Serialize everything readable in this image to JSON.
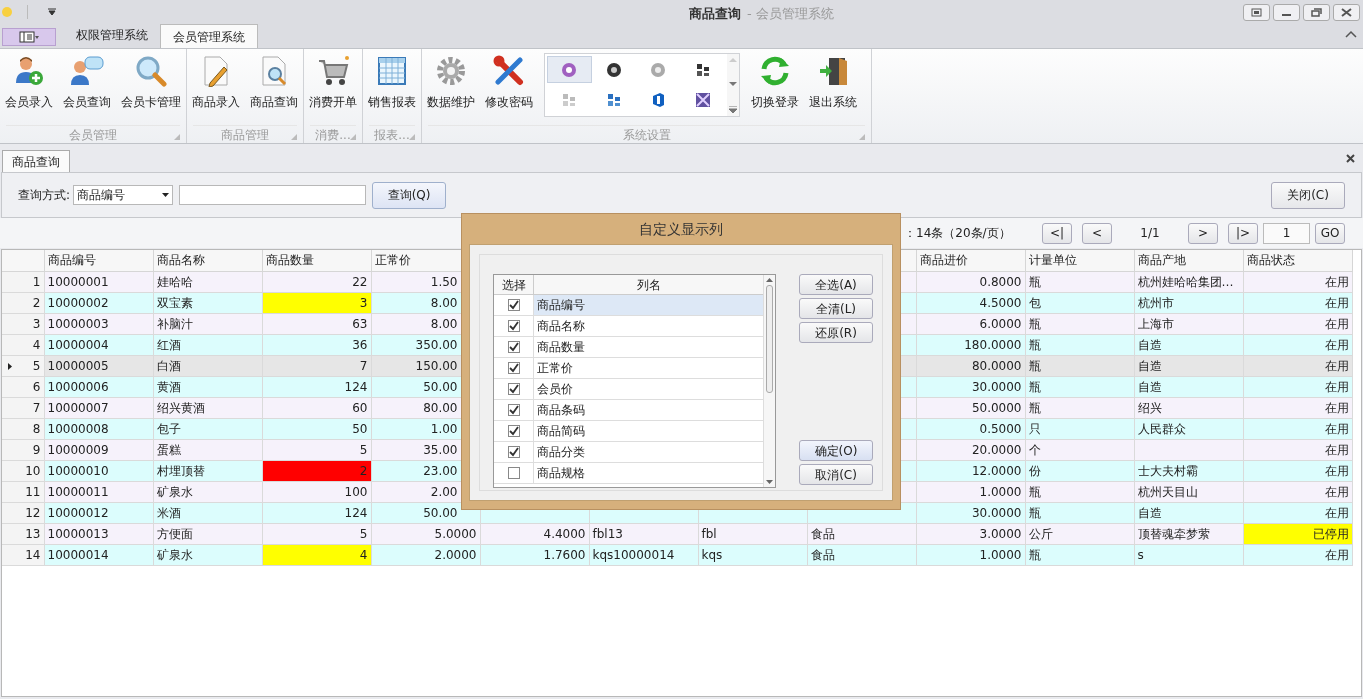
{
  "window": {
    "title": "商品查询",
    "app_name": "- 会员管理系统"
  },
  "ribbon": {
    "tabs": [
      {
        "label": "权限管理系统",
        "selected": false
      },
      {
        "label": "会员管理系统",
        "selected": true
      }
    ],
    "groups": [
      {
        "label": "会员管理",
        "items": [
          {
            "kind": "button",
            "label": "会员录入"
          },
          {
            "kind": "button",
            "label": "会员查询"
          },
          {
            "kind": "button",
            "label": "会员卡管理"
          }
        ]
      },
      {
        "label": "商品管理",
        "items": [
          {
            "kind": "button",
            "label": "商品录入"
          },
          {
            "kind": "button",
            "label": "商品查询"
          }
        ]
      },
      {
        "label": "消费...",
        "items": [
          {
            "kind": "button",
            "label": "消费开单"
          }
        ]
      },
      {
        "label": "报表...",
        "items": [
          {
            "kind": "button",
            "label": "销售报表"
          }
        ]
      },
      {
        "label": "系统设置",
        "items": [
          {
            "kind": "button",
            "label": "数据维护"
          },
          {
            "kind": "button",
            "label": "修改密码"
          },
          {
            "kind": "gallery",
            "items": [
              {
                "selected": true
              },
              {
                "selected": false
              },
              {
                "selected": false
              },
              {
                "selected": false
              },
              {
                "selected": false
              },
              {
                "selected": false
              },
              {
                "selected": false
              },
              {
                "selected": false
              }
            ]
          },
          {
            "kind": "button",
            "label": "切换登录"
          },
          {
            "kind": "button",
            "label": "退出系统"
          }
        ]
      }
    ]
  },
  "document_tab": {
    "label": "商品查询",
    "selected": true
  },
  "query": {
    "label": "查询方式:",
    "mode": "商品编号",
    "search_button": "查询(Q)",
    "close_button": "关闭(C)"
  },
  "pagination": {
    "summary": "：14条（20条/页）",
    "first": "<|",
    "prev": "<",
    "page": "1/1",
    "next": ">",
    "last": "|>",
    "page_input": "1",
    "go": "GO"
  },
  "table": {
    "columns": [
      "商品编号",
      "商品名称",
      "商品数量",
      "正常价",
      "商品进价",
      "计量单位",
      "商品产地",
      "商品状态"
    ],
    "rows": [
      {
        "no": "1",
        "id": "10000001",
        "name": "娃哈哈",
        "qty": "22",
        "low_stock": false,
        "critical_stock": false,
        "price": "1.50",
        "cost": "0.8000",
        "unit": "瓶",
        "origin": "杭州娃哈哈集团…",
        "status": "在用",
        "disabled": false,
        "selected": false
      },
      {
        "no": "2",
        "id": "10000002",
        "name": "双宝素",
        "qty": "3",
        "low_stock": true,
        "critical_stock": false,
        "price": "8.00",
        "cost": "4.5000",
        "unit": "包",
        "origin": "杭州市",
        "status": "在用",
        "disabled": false,
        "selected": false
      },
      {
        "no": "3",
        "id": "10000003",
        "name": "补脑汁",
        "qty": "63",
        "low_stock": false,
        "critical_stock": false,
        "price": "8.00",
        "cost": "6.0000",
        "unit": "瓶",
        "origin": "上海市",
        "status": "在用",
        "disabled": false,
        "selected": false
      },
      {
        "no": "4",
        "id": "10000004",
        "name": "红酒",
        "qty": "36",
        "low_stock": false,
        "critical_stock": false,
        "price": "350.00",
        "cost": "180.0000",
        "unit": "瓶",
        "origin": "自造",
        "status": "在用",
        "disabled": false,
        "selected": false
      },
      {
        "no": "5",
        "id": "10000005",
        "name": "白酒",
        "qty": "7",
        "low_stock": false,
        "critical_stock": false,
        "price": "150.00",
        "cost": "80.0000",
        "unit": "瓶",
        "origin": "自造",
        "status": "在用",
        "disabled": false,
        "selected": true
      },
      {
        "no": "6",
        "id": "10000006",
        "name": "黄酒",
        "qty": "124",
        "low_stock": false,
        "critical_stock": false,
        "price": "50.00",
        "cost": "30.0000",
        "unit": "瓶",
        "origin": "自造",
        "status": "在用",
        "disabled": false,
        "selected": false
      },
      {
        "no": "7",
        "id": "10000007",
        "name": "绍兴黄酒",
        "qty": "60",
        "low_stock": false,
        "critical_stock": false,
        "price": "80.00",
        "cost": "50.0000",
        "unit": "瓶",
        "origin": "绍兴",
        "status": "在用",
        "disabled": false,
        "selected": false
      },
      {
        "no": "8",
        "id": "10000008",
        "name": "包子",
        "qty": "50",
        "low_stock": false,
        "critical_stock": false,
        "price": "1.00",
        "cost": "0.5000",
        "unit": "只",
        "origin": "人民群众",
        "status": "在用",
        "disabled": false,
        "selected": false
      },
      {
        "no": "9",
        "id": "10000009",
        "name": "蛋糕",
        "qty": "5",
        "low_stock": false,
        "critical_stock": false,
        "price": "35.00",
        "cost": "20.0000",
        "unit": "个",
        "status": "在用",
        "disabled": false,
        "selected": false
      },
      {
        "no": "10",
        "id": "10000010",
        "name": "村埋顶替",
        "qty": "2",
        "low_stock": false,
        "critical_stock": true,
        "price": "23.00",
        "cost": "12.0000",
        "unit": "份",
        "origin": "士大夫村霸",
        "status": "在用",
        "disabled": false,
        "selected": false
      },
      {
        "no": "11",
        "id": "10000011",
        "name": "矿泉水",
        "qty": "100",
        "low_stock": false,
        "critical_stock": false,
        "price": "2.00",
        "cost": "1.0000",
        "unit": "瓶",
        "origin": "杭州天目山",
        "status": "在用",
        "disabled": false,
        "selected": false
      },
      {
        "no": "12",
        "id": "10000012",
        "name": "米酒",
        "qty": "124",
        "low_stock": false,
        "critical_stock": false,
        "price": "50.00",
        "cost": "30.0000",
        "unit": "瓶",
        "origin": "自造",
        "status": "在用",
        "disabled": false,
        "selected": false
      },
      {
        "no": "13",
        "id": "10000013",
        "name": "方便面",
        "qty": "5",
        "low_stock": false,
        "critical_stock": false,
        "price": "5.0000",
        "member_price": "4.4000",
        "barcode": "fbl13",
        "code": "fbl",
        "category": "食品",
        "cost": "3.0000",
        "unit": "公斤",
        "origin": "顶替魂牵梦萦",
        "status": "已停用",
        "disabled": true,
        "selected": false
      },
      {
        "no": "14",
        "id": "10000014",
        "name": "矿泉水",
        "qty": "4",
        "low_stock": true,
        "critical_stock": false,
        "price": "2.0000",
        "member_price": "1.7600",
        "barcode": "kqs10000014",
        "code": "kqs",
        "category": "食品",
        "cost": "1.0000",
        "unit": "瓶",
        "origin": "s",
        "status": "在用",
        "disabled": false,
        "selected": false
      }
    ]
  },
  "dialog": {
    "title": "自定义显示列",
    "headers": [
      "选择",
      "列名"
    ],
    "items": [
      {
        "label": "商品编号",
        "checked": true,
        "selected": true
      },
      {
        "label": "商品名称",
        "checked": true,
        "selected": false
      },
      {
        "label": "商品数量",
        "checked": true,
        "selected": false
      },
      {
        "label": "正常价",
        "checked": true,
        "selected": false
      },
      {
        "label": "会员价",
        "checked": true,
        "selected": false
      },
      {
        "label": "商品条码",
        "checked": true,
        "selected": false
      },
      {
        "label": "商品简码",
        "checked": true,
        "selected": false
      },
      {
        "label": "商品分类",
        "checked": true,
        "selected": false
      },
      {
        "label": "商品规格",
        "checked": false,
        "selected": false
      }
    ],
    "buttons": [
      "全选(A)",
      "全清(L)",
      "还原(R)"
    ],
    "ok": "确定(O)",
    "cancel": "取消(C)"
  }
}
